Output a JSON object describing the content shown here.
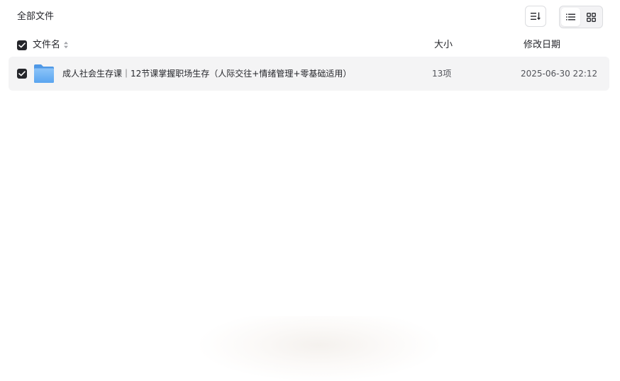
{
  "header": {
    "title": "全部文件"
  },
  "toolbar": {
    "sort_icon": "sort-list-icon",
    "view_list_icon": "list-view-icon",
    "view_grid_icon": "grid-view-icon",
    "active_view": "list"
  },
  "columns": {
    "name": "文件名",
    "size": "大小",
    "modified": "修改日期"
  },
  "files": [
    {
      "name": "成人社会生存课｜12节课掌握职场生存（人际交往+情绪管理+零基础适用）",
      "size": "13项",
      "modified": "2025-06-30 22:12",
      "type": "folder",
      "checked": true
    }
  ],
  "select_all_checked": true,
  "colors": {
    "text": "#25262b",
    "muted": "#52545a",
    "row_bg": "#f4f4f5",
    "folder_blue": "#6fb2f5",
    "border": "#dcdde0"
  }
}
